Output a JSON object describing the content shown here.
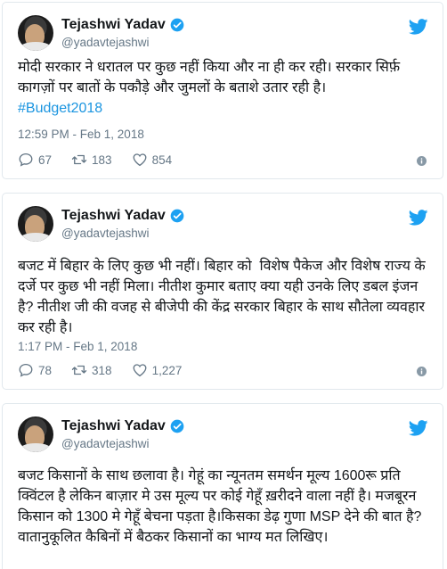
{
  "tweets": [
    {
      "name": "Tejashwi Yadav",
      "handle": "@yadavtejashwi",
      "text": "मोदी सरकार ने धरातल पर कुछ नहीं किया और ना ही कर रही। सरकार सिर्फ़ कागज़ों पर बातों के पकौड़े और जुमलों के बताशे उतार रही है।",
      "hashtag": "#Budget2018",
      "timestamp": "12:59 PM - Feb 1, 2018",
      "replies": "67",
      "retweets": "183",
      "likes": "854"
    },
    {
      "name": "Tejashwi Yadav",
      "handle": "@yadavtejashwi",
      "text": "बजट में बिहार के लिए कुछ भी नहीं। बिहार को  विशेष पैकेज और विशेष राज्य के दर्जे पर कुछ भी नहीं मिला। नीतीश कुमार बताए क्या यही उनके लिए डबल इंजन है? नीतीश जी की वजह से बीजेपी की केंद्र सरकार बिहार के साथ सौतेला व्यवहार कर रही है।",
      "timestamp": "1:17 PM - Feb 1, 2018",
      "replies": "78",
      "retweets": "318",
      "likes": "1,227"
    },
    {
      "name": "Tejashwi Yadav",
      "handle": "@yadavtejashwi",
      "text": "बजट किसानों के साथ छलावा है। गेहूं का न्यूनतम समर्थन मूल्य 1600रू प्रति क्विंटल है लेकिन बाज़ार मे उस मूल्य पर कोई गेहूँ ख़रीदने वाला नहीं है। मजबूरन किसान को 1300 मे गेहूँ बेचना पड़ता है।किसका डेढ़ गुणा MSP देने की बात है? वातानुकूलित कैबिनों में बैठकर किसानों का भाग्य मत लिखिए।"
    }
  ],
  "icons": {
    "verified": "verified-badge-icon",
    "bird": "twitter-bird-icon",
    "reply": "reply-icon",
    "retweet": "retweet-icon",
    "like": "heart-icon",
    "info": "info-icon"
  },
  "colors": {
    "accent": "#1da1f2",
    "link": "#1b95e0",
    "muted": "#657786",
    "border": "#e1e8ed"
  }
}
